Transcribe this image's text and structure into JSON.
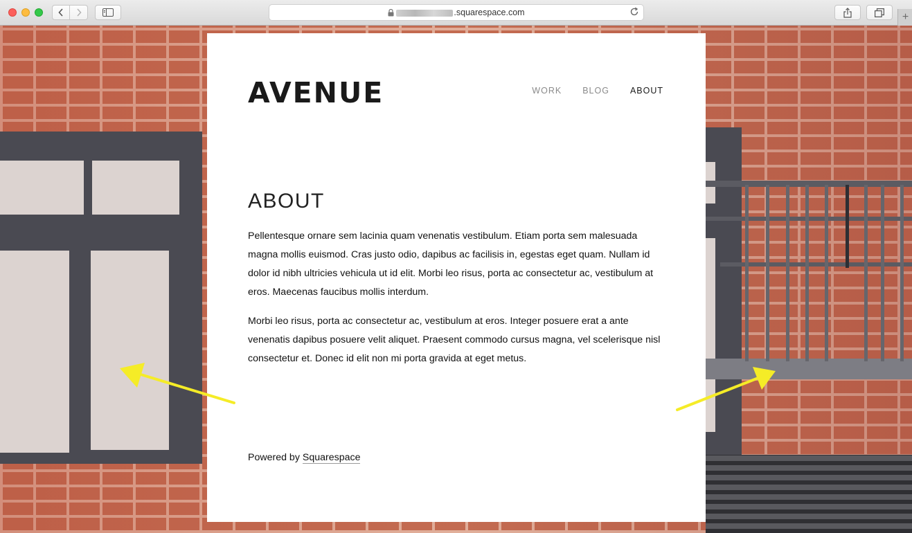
{
  "browser": {
    "url_suffix": ".squarespace.com"
  },
  "site": {
    "logo": "AVENUE",
    "nav": [
      {
        "label": "WORK"
      },
      {
        "label": "BLOG"
      },
      {
        "label": "ABOUT"
      }
    ],
    "page_title": "ABOUT",
    "paragraphs": [
      "Pellentesque ornare sem lacinia quam venenatis vestibulum. Etiam porta sem malesuada magna mollis euismod. Cras justo odio, dapibus ac facilisis in, egestas eget quam. Nullam id dolor id nibh ultricies vehicula ut id elit. Morbi leo risus, porta ac consectetur ac, vestibulum at eros. Maecenas faucibus mollis interdum.",
      "Morbi leo risus, porta ac consectetur ac, vestibulum at eros. Integer posuere erat a ante venenatis dapibus posuere velit aliquet. Praesent commodo cursus magna, vel scelerisque nisl consectetur et. Donec id elit non mi porta gravida at eget metus."
    ],
    "footer": {
      "prefix": "Powered by ",
      "link": "Squarespace"
    }
  },
  "colors": {
    "arrow": "#f5ec27",
    "nav_active": "#1a1a1a",
    "nav_inactive": "#8a8a8a"
  },
  "icons": [
    "back-icon",
    "forward-icon",
    "sidebar-icon",
    "lock-icon",
    "reload-icon",
    "share-icon",
    "tabs-icon",
    "plus-icon"
  ]
}
